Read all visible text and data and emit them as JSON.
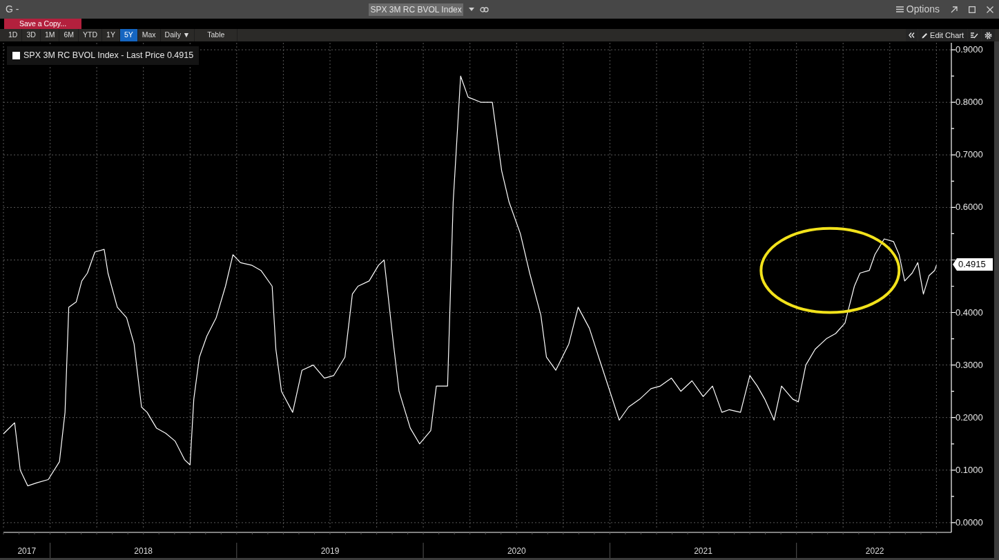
{
  "window": {
    "title_prefix": "G -",
    "security": "SPX 3M RC BVOL Index",
    "options": "Options"
  },
  "save_button": "Save a Copy...",
  "ranges": [
    {
      "label": "1D",
      "selected": false
    },
    {
      "label": "3D",
      "selected": false
    },
    {
      "label": "1M",
      "selected": false
    },
    {
      "label": "6M",
      "selected": false
    },
    {
      "label": "YTD",
      "selected": false
    },
    {
      "label": "1Y",
      "selected": false
    },
    {
      "label": "5Y",
      "selected": true
    },
    {
      "label": "Max",
      "selected": false
    }
  ],
  "frequency": {
    "label": "Daily",
    "caret": "▼"
  },
  "table_button": "Table",
  "edit_chart": "Edit Chart",
  "legend_value": "0.4915",
  "highlight_ring": true,
  "first_year_label": "2017",
  "last_value_tag": "0.4915",
  "chart_data": {
    "type": "line",
    "x": [
      2017.75,
      2017.81,
      2017.84,
      2017.88,
      2017.93,
      2017.99,
      2018.05,
      2018.08,
      2018.1,
      2018.14,
      2018.17,
      2018.2,
      2018.24,
      2018.29,
      2018.31,
      2018.36,
      2018.41,
      2018.45,
      2018.49,
      2018.52,
      2018.57,
      2018.62,
      2018.67,
      2018.72,
      2018.75,
      2018.77,
      2018.8,
      2018.84,
      2018.89,
      2018.94,
      2018.98,
      2019.02,
      2019.08,
      2019.13,
      2019.19,
      2019.21,
      2019.24,
      2019.3,
      2019.35,
      2019.41,
      2019.47,
      2019.52,
      2019.58,
      2019.62,
      2019.65,
      2019.71,
      2019.76,
      2019.79,
      2019.84,
      2019.87,
      2019.93,
      2019.98,
      2020.04,
      2020.07,
      2020.13,
      2020.16,
      2020.2,
      2020.24,
      2020.31,
      2020.37,
      2020.42,
      2020.46,
      2020.52,
      2020.57,
      2020.63,
      2020.66,
      2020.71,
      2020.78,
      2020.83,
      2020.89,
      2020.94,
      2021.0,
      2021.05,
      2021.1,
      2021.16,
      2021.22,
      2021.27,
      2021.33,
      2021.38,
      2021.44,
      2021.5,
      2021.55,
      2021.6,
      2021.64,
      2021.7,
      2021.75,
      2021.79,
      2021.83,
      2021.88,
      2021.92,
      2021.98,
      2022.01,
      2022.05,
      2022.1,
      2022.16,
      2022.21,
      2022.26,
      2022.31,
      2022.34,
      2022.39,
      2022.42,
      2022.47,
      2022.52,
      2022.55,
      2022.58,
      2022.62,
      2022.65,
      2022.68,
      2022.71,
      2022.74,
      2022.75
    ],
    "series": [
      {
        "name": "SPX 3M RC BVOL Index - Last Price",
        "color": "#ffffff",
        "values": [
          0.169,
          0.19,
          0.1,
          0.07,
          0.076,
          0.082,
          0.116,
          0.21,
          0.41,
          0.42,
          0.46,
          0.475,
          0.515,
          0.52,
          0.475,
          0.41,
          0.39,
          0.34,
          0.22,
          0.21,
          0.18,
          0.17,
          0.155,
          0.12,
          0.11,
          0.235,
          0.315,
          0.355,
          0.39,
          0.45,
          0.51,
          0.495,
          0.49,
          0.48,
          0.45,
          0.33,
          0.25,
          0.21,
          0.29,
          0.3,
          0.275,
          0.28,
          0.315,
          0.435,
          0.45,
          0.46,
          0.49,
          0.5,
          0.34,
          0.25,
          0.18,
          0.15,
          0.175,
          0.26,
          0.26,
          0.61,
          0.85,
          0.81,
          0.8,
          0.8,
          0.67,
          0.61,
          0.55,
          0.475,
          0.395,
          0.315,
          0.29,
          0.34,
          0.41,
          0.37,
          0.315,
          0.25,
          0.195,
          0.22,
          0.235,
          0.255,
          0.26,
          0.275,
          0.25,
          0.27,
          0.24,
          0.26,
          0.21,
          0.215,
          0.21,
          0.28,
          0.26,
          0.235,
          0.195,
          0.26,
          0.235,
          0.23,
          0.3,
          0.33,
          0.35,
          0.36,
          0.38,
          0.45,
          0.475,
          0.48,
          0.51,
          0.54,
          0.535,
          0.51,
          0.46,
          0.475,
          0.495,
          0.435,
          0.47,
          0.48,
          0.49
        ]
      }
    ],
    "xlim": [
      2017.75,
      2022.83
    ],
    "ylim": [
      -0.0133,
      0.9133
    ],
    "xticks": [
      {
        "value": 2018.5,
        "label": "2018"
      },
      {
        "value": 2019.5,
        "label": "2019"
      },
      {
        "value": 2020.5,
        "label": "2020"
      },
      {
        "value": 2021.5,
        "label": "2021"
      },
      {
        "value": 2022.42,
        "label": "2022"
      }
    ],
    "grid": true,
    "yticks": [
      {
        "value": 0,
        "label": "0.0000"
      },
      {
        "value": 0.1,
        "label": "0.1000"
      },
      {
        "value": 0.2,
        "label": "0.2000"
      },
      {
        "value": 0.3,
        "label": "0.3000"
      },
      {
        "value": 0.4,
        "label": "0.4000"
      },
      {
        "value": 0.6,
        "label": "0.6000"
      },
      {
        "value": 0.7,
        "label": "0.7000"
      },
      {
        "value": 0.8,
        "label": "0.8000"
      },
      {
        "value": 0.9,
        "label": "0.9000"
      }
    ]
  }
}
